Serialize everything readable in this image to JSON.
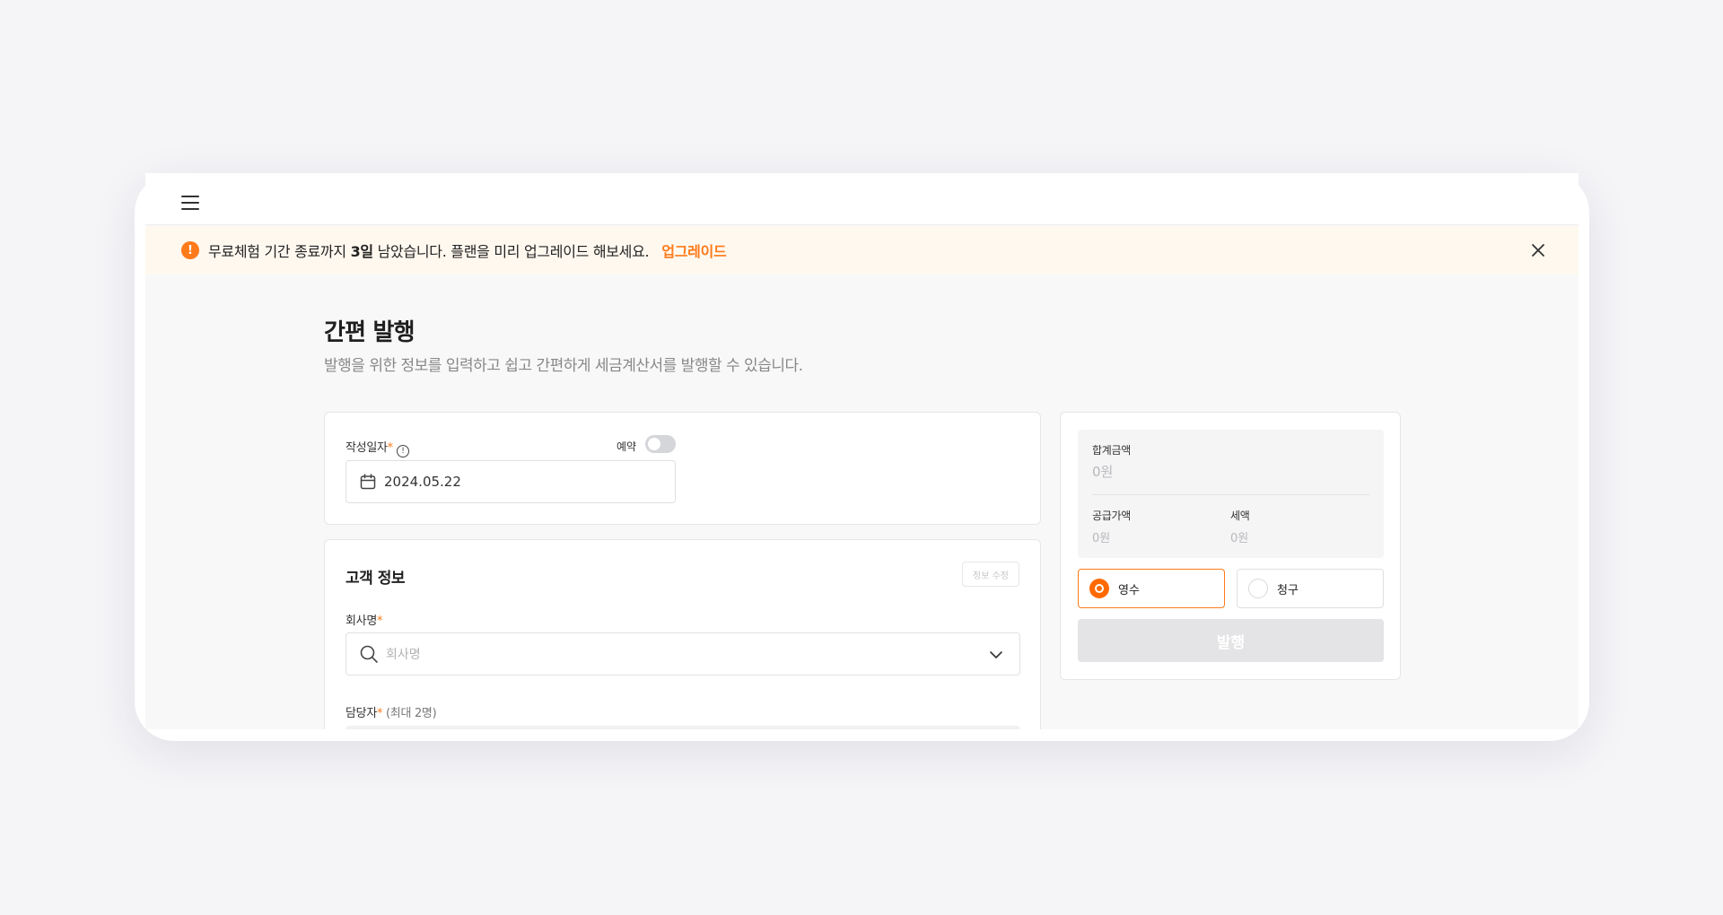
{
  "topbar": {
    "menu_icon": "hamburger-menu-icon"
  },
  "banner": {
    "icon": "alert-icon",
    "icon_glyph": "!",
    "text_before": "무료체험 기간 종료까지 ",
    "days": "3일",
    "text_after": " 남았습니다. 플랜을 미리 업그레이드 해보세요.",
    "link_label": "업그레이드",
    "close_icon": "close-icon"
  },
  "page": {
    "title": "간편 발행",
    "subtitle": "발행을 위한 정보를 입력하고 쉽고 간편하게 세금계산서를 발행할 수 있습니다."
  },
  "date_card": {
    "label": "작성일자",
    "required_mark": "*",
    "info_glyph": "!",
    "reserve_label": "예약",
    "reserve_enabled": false,
    "date_value": "2024.05.22"
  },
  "customer": {
    "title": "고객 정보",
    "edit_label": "정보 수정",
    "company_label": "회사명",
    "required_mark": "*",
    "company_placeholder": "회사명",
    "manager_label": "담당자",
    "manager_hint": " (최대 2명)"
  },
  "summary": {
    "total_label": "합계금액",
    "total_value": "0원",
    "supply_label": "공급가액",
    "supply_value": "0원",
    "tax_label": "세액",
    "tax_value": "0원",
    "type_options": [
      "영수",
      "청구"
    ],
    "selected_type": "영수",
    "issue_button": "발행"
  },
  "colors": {
    "accent": "#ff7a1a",
    "banner_bg": "#fff8ef",
    "disabled_button": "#e4e4e6"
  }
}
